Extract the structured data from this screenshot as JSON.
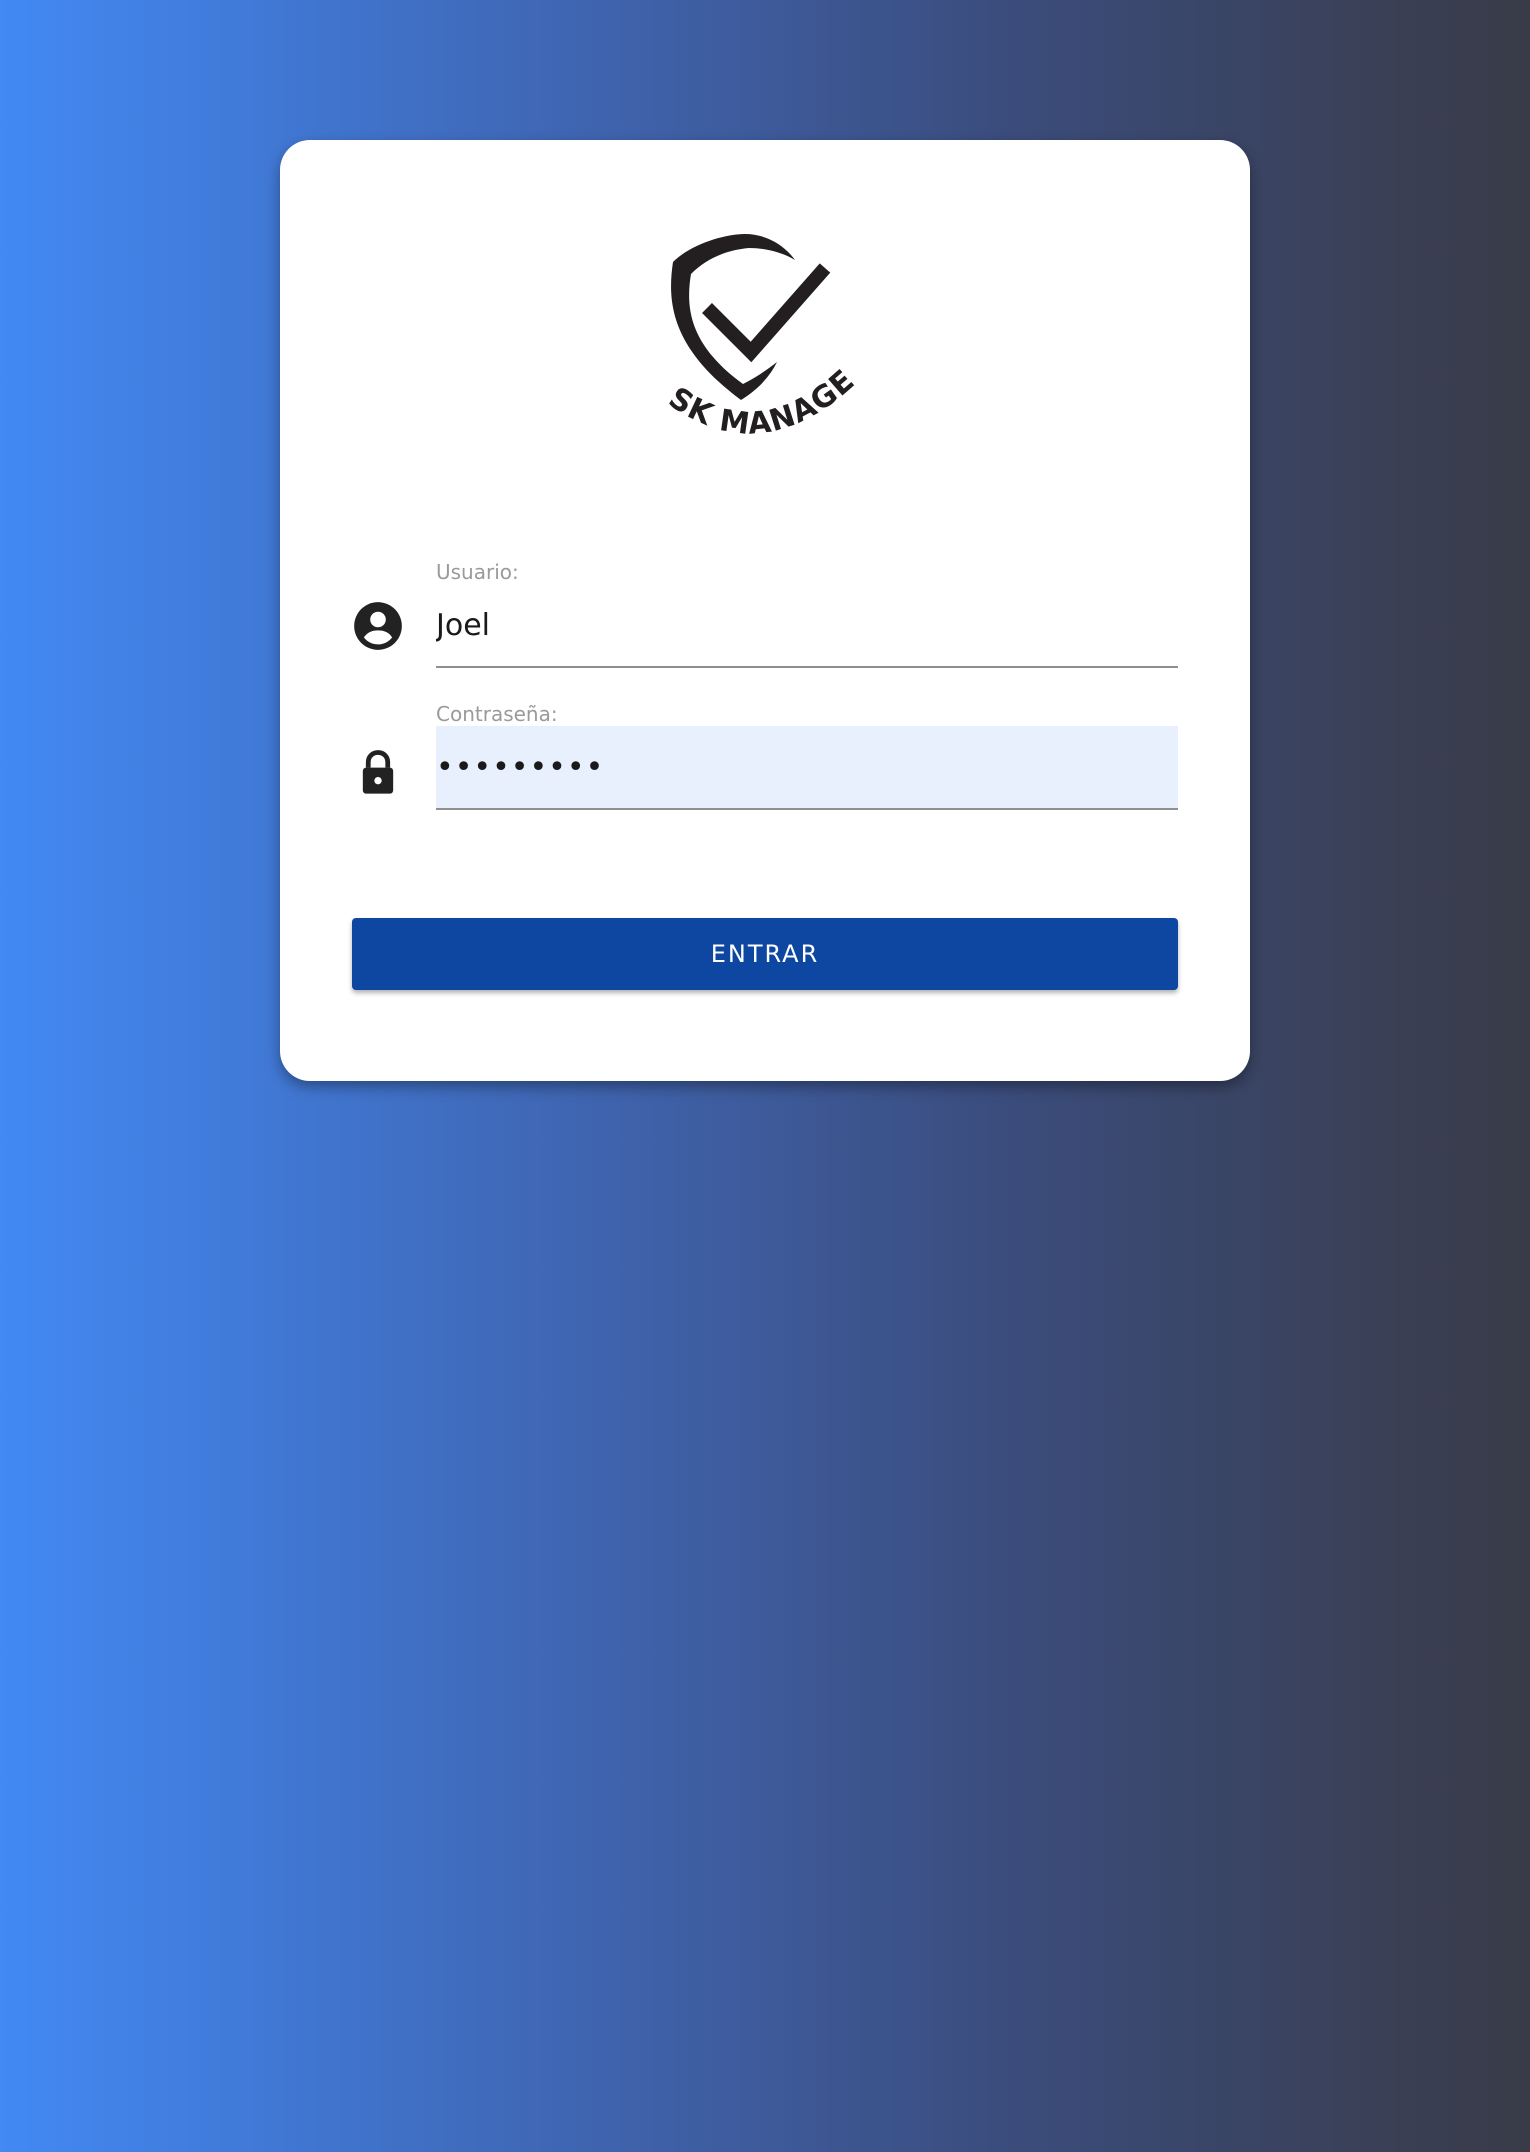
{
  "logo": {
    "text": "RISK MANAGER",
    "icon": "shield-check-icon"
  },
  "form": {
    "username": {
      "label": "Usuario:",
      "value": "Joel",
      "icon": "account-circle-icon"
    },
    "password": {
      "label": "Contraseña:",
      "value": "•••••••••",
      "icon": "lock-icon"
    },
    "submit_label": "ENTRAR"
  },
  "colors": {
    "button": "#0d47a1",
    "autofill": "#e8f0fe",
    "gradient_start": "#4289f4",
    "gradient_end": "#393b47"
  }
}
